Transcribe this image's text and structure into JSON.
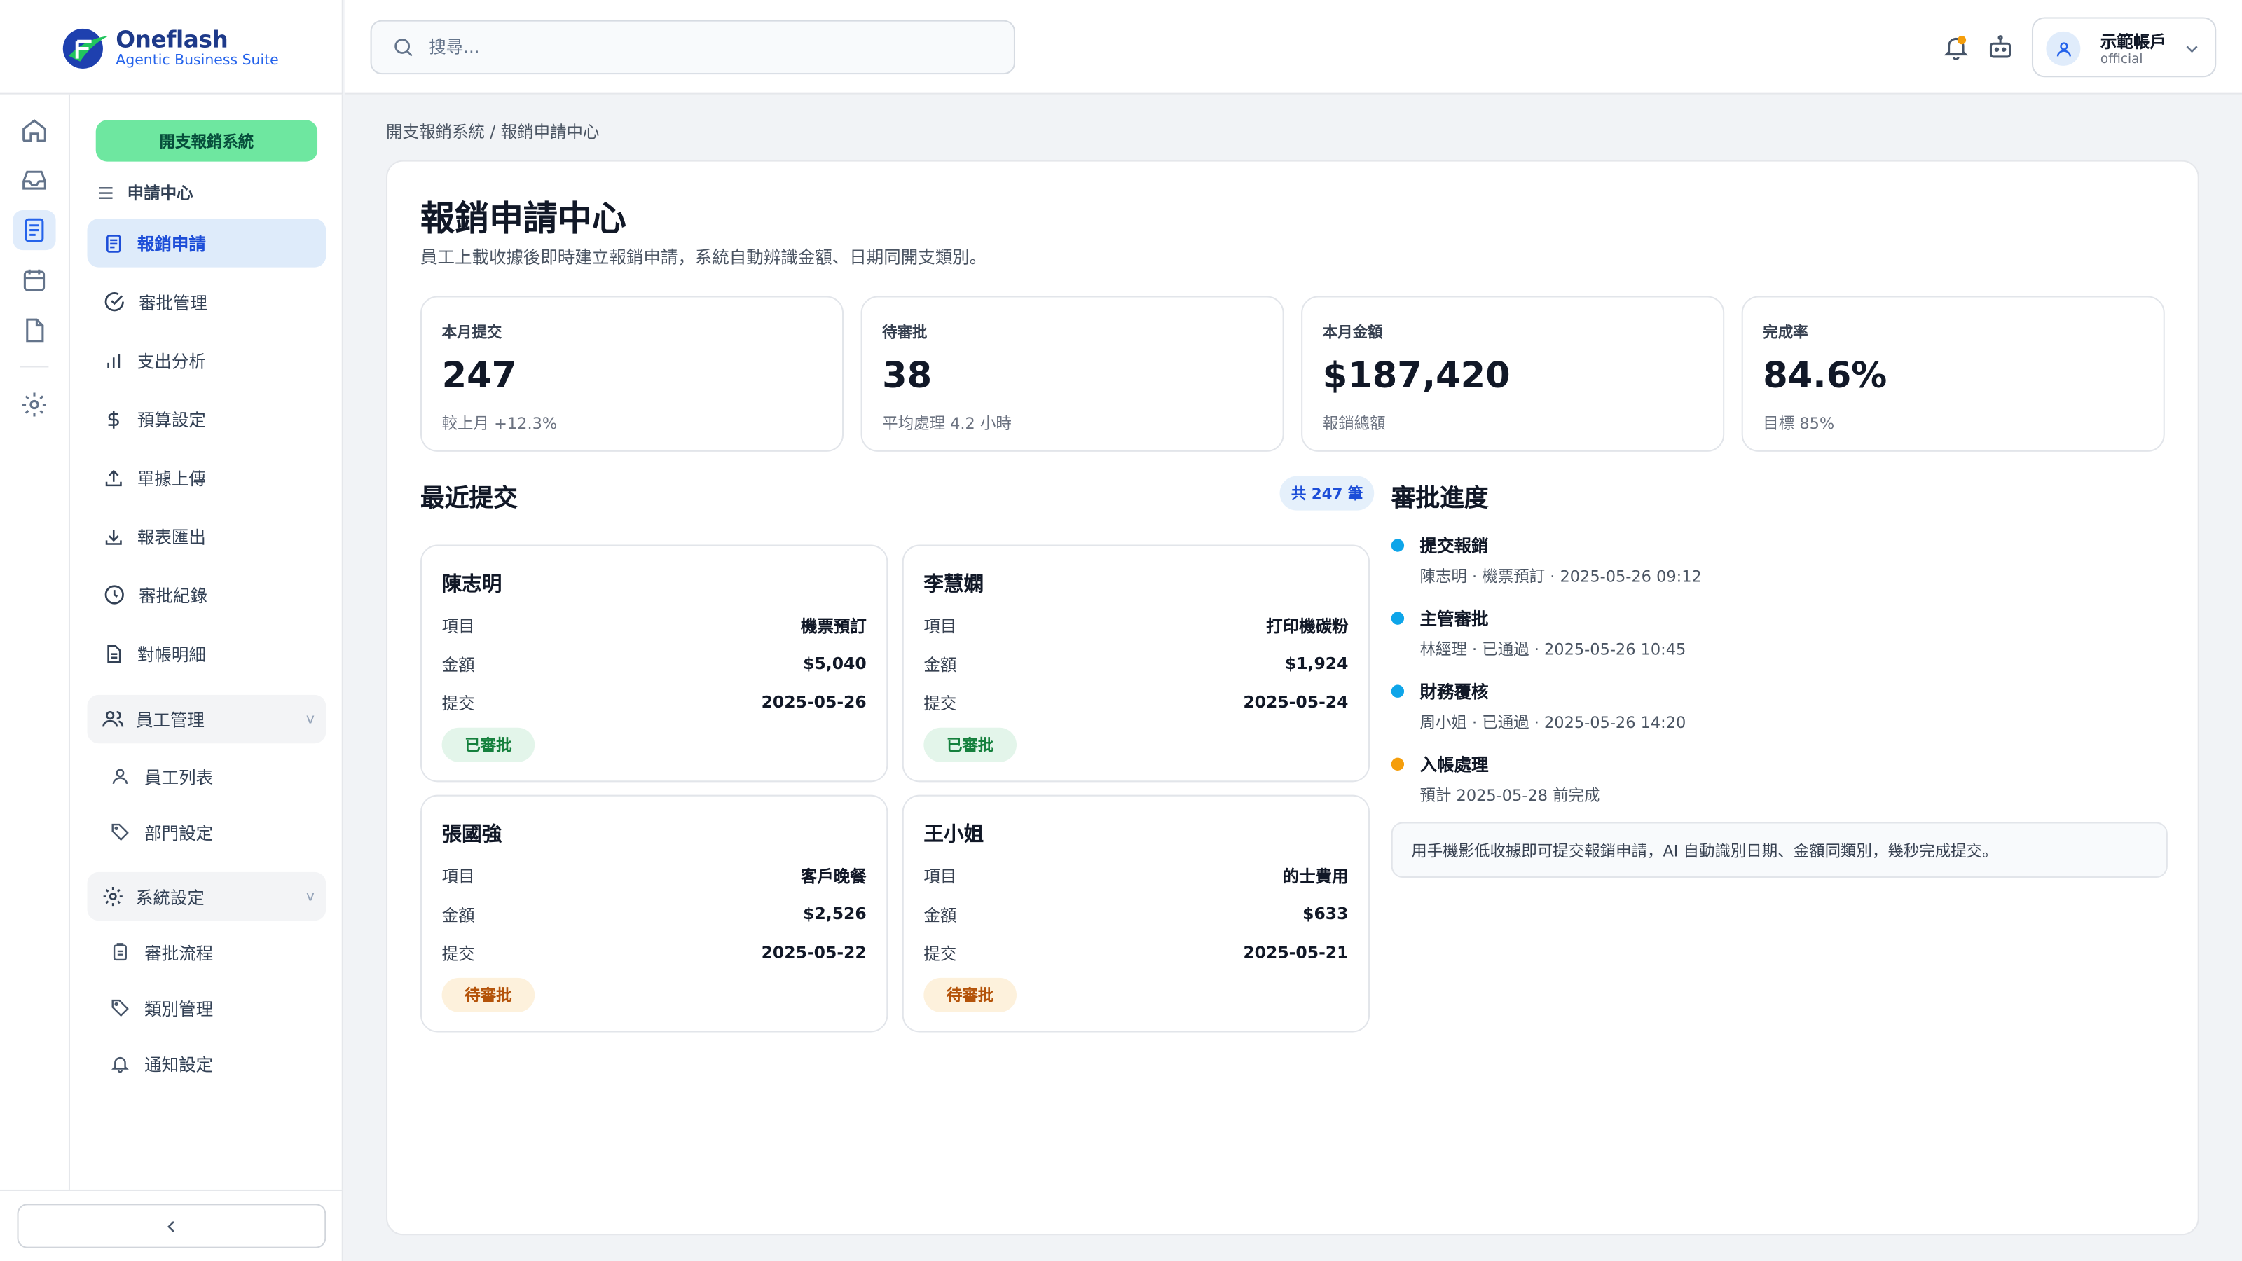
{
  "brand": {
    "name": "Oneflash",
    "tagline": "Agentic Business Suite"
  },
  "search": {
    "placeholder": "搜尋..."
  },
  "account": {
    "name": "示範帳戶",
    "role": "official"
  },
  "nav": {
    "system_button": "開支報銷系統",
    "section_label": "申請中心",
    "items": [
      {
        "label": "報銷申請",
        "icon": "receipt-icon",
        "active": true
      },
      {
        "label": "審批管理",
        "icon": "check-circle-icon"
      },
      {
        "label": "支出分析",
        "icon": "bar-chart-icon"
      },
      {
        "label": "預算設定",
        "icon": "dollar-icon"
      },
      {
        "label": "單據上傳",
        "icon": "upload-icon"
      },
      {
        "label": "報表匯出",
        "icon": "download-icon"
      },
      {
        "label": "審批紀錄",
        "icon": "clock-icon"
      },
      {
        "label": "對帳明細",
        "icon": "document-icon"
      }
    ],
    "groups": [
      {
        "label": "員工管理",
        "chevron": "v",
        "children": [
          {
            "label": "員工列表"
          },
          {
            "label": "部門設定"
          }
        ]
      },
      {
        "label": "系統設定",
        "chevron": "v",
        "children": [
          {
            "label": "審批流程"
          },
          {
            "label": "類別管理"
          },
          {
            "label": "通知設定"
          }
        ]
      }
    ]
  },
  "breadcrumb": "開支報銷系統 / 報銷申請中心",
  "page": {
    "title": "報銷申請中心",
    "description": "員工上載收據後即時建立報銷申請，系統自動辨識金額、日期同開支類別。"
  },
  "stats": [
    {
      "label": "本月提交",
      "value": "247",
      "sub": "較上月 +12.3%"
    },
    {
      "label": "待審批",
      "value": "38",
      "sub": "平均處理 4.2 小時"
    },
    {
      "label": "本月金額",
      "value": "$187,420",
      "sub": "報銷總額"
    },
    {
      "label": "完成率",
      "value": "84.6%",
      "sub": "目標 85%"
    }
  ],
  "recent": {
    "title": "最近提交",
    "count_badge": "共 247 筆",
    "field_labels": {
      "item": "項目",
      "amount": "金額",
      "date": "提交"
    },
    "cards": [
      {
        "name": "陳志明",
        "item": "機票預訂",
        "amount": "$5,040",
        "date": "2025-05-26",
        "status": "已審批",
        "status_type": "approved"
      },
      {
        "name": "李慧嫻",
        "item": "打印機碳粉",
        "amount": "$1,924",
        "date": "2025-05-24",
        "status": "已審批",
        "status_type": "approved"
      },
      {
        "name": "張國強",
        "item": "客戶晚餐",
        "amount": "$2,526",
        "date": "2025-05-22",
        "status": "待審批",
        "status_type": "pending"
      },
      {
        "name": "王小姐",
        "item": "的士費用",
        "amount": "$633",
        "date": "2025-05-21",
        "status": "待審批",
        "status_type": "pending"
      }
    ]
  },
  "progress": {
    "title": "審批進度",
    "steps": [
      {
        "title": "提交報銷",
        "detail": "陳志明 · 機票預訂 · 2025-05-26 09:12",
        "dot_color": "#0ea5e9"
      },
      {
        "title": "主管審批",
        "detail": "林經理 · 已通過 · 2025-05-26 10:45",
        "dot_color": "#0ea5e9"
      },
      {
        "title": "財務覆核",
        "detail": "周小姐 · 已通過 · 2025-05-26 14:20",
        "dot_color": "#0ea5e9"
      },
      {
        "title": "入帳處理",
        "detail": "預計 2025-05-28 前完成",
        "dot_color": "#f59e0b"
      }
    ],
    "note": "用手機影低收據即可提交報銷申請，AI 自動識別日期、金額同類別，幾秒完成提交。"
  },
  "colors": {
    "accent": "#2563eb",
    "primary_button": "#6ee7a0",
    "approved": "#15803d",
    "pending": "#b45309"
  }
}
